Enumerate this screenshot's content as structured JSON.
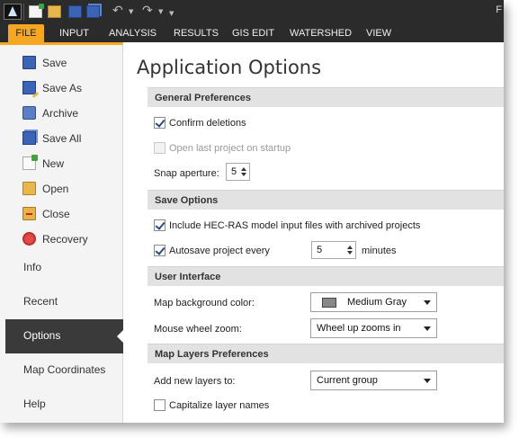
{
  "titlebar": {
    "right_text": "F"
  },
  "ribbon": {
    "tabs": [
      "FILE",
      "INPUT",
      "ANALYSIS",
      "RESULTS",
      "GIS EDIT",
      "WATERSHED",
      "VIEW"
    ],
    "active_tab": "FILE"
  },
  "nav": {
    "file_items": [
      {
        "label": "Save",
        "icon": "save-icon"
      },
      {
        "label": "Save As",
        "icon": "save-as-icon"
      },
      {
        "label": "Archive",
        "icon": "archive-icon"
      },
      {
        "label": "Save All",
        "icon": "save-all-icon"
      },
      {
        "label": "New",
        "icon": "new-icon"
      },
      {
        "label": "Open",
        "icon": "open-folder-icon"
      },
      {
        "label": "Close",
        "icon": "close-folder-icon"
      },
      {
        "label": "Recovery",
        "icon": "recovery-icon"
      }
    ],
    "sections": [
      "Info",
      "Recent",
      "Options",
      "Map Coordinates",
      "Help"
    ],
    "active_section": "Options"
  },
  "main": {
    "title": "Application Options",
    "general": {
      "header": "General Preferences",
      "confirm_deletions": {
        "label": "Confirm deletions",
        "checked": true
      },
      "open_last_project": {
        "label": "Open last project on startup",
        "checked": false,
        "disabled": true
      },
      "snap_aperture": {
        "label": "Snap aperture:",
        "value": "5"
      }
    },
    "save": {
      "header": "Save Options",
      "include_hecras": {
        "label": "Include HEC-RAS model input files with archived projects",
        "checked": true
      },
      "autosave": {
        "label": "Autosave project every",
        "checked": true,
        "value": "5",
        "unit": "minutes"
      }
    },
    "ui": {
      "header": "User Interface",
      "map_bg": {
        "label": "Map background color:",
        "value": "Medium Gray",
        "swatch": "#888888"
      },
      "wheel_zoom": {
        "label": "Mouse wheel zoom:",
        "value": "Wheel up zooms in"
      }
    },
    "layers": {
      "header": "Map Layers Preferences",
      "add_new": {
        "label": "Add new layers to:",
        "value": "Current group"
      },
      "capitalize": {
        "label": "Capitalize layer names",
        "checked": false
      }
    }
  },
  "colors": {
    "accent": "#f5a623",
    "dark_bar": "#2b2b2b",
    "active_nav": "#3a3a3a"
  }
}
